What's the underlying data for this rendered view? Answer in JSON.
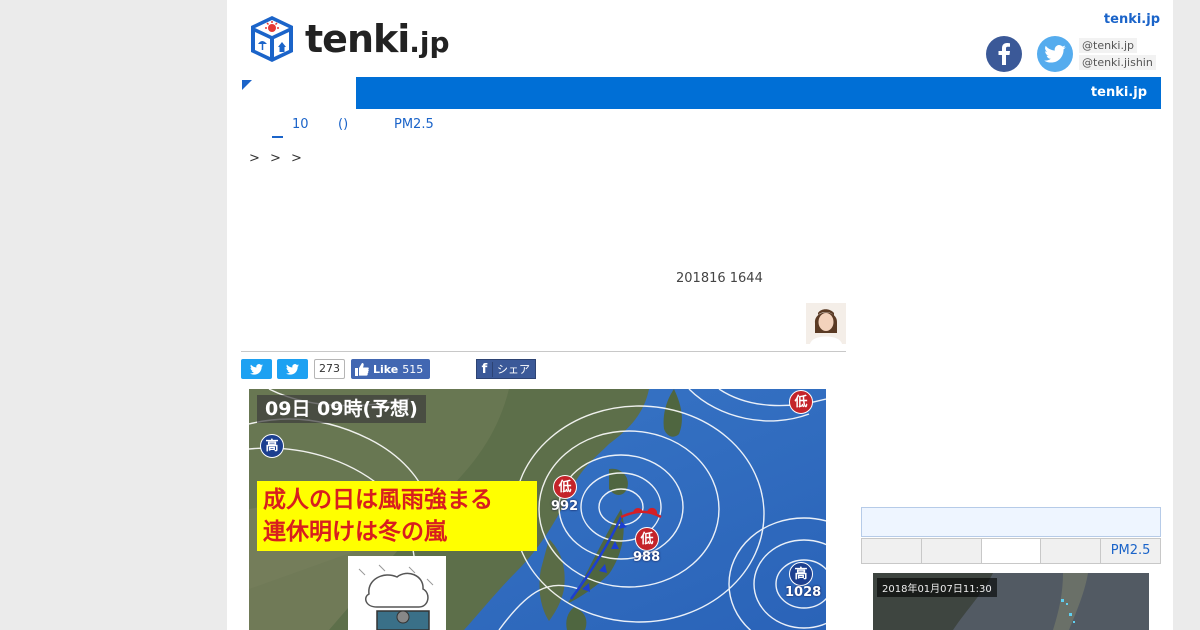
{
  "header": {
    "logo_text": "tenki",
    "logo_suffix": ".jp",
    "top_link": "tenki.jp",
    "social": {
      "handle_main": "@tenki.jp",
      "handle_jishin": "@tenki.jishin"
    }
  },
  "nav": {
    "title": "tenki.jp"
  },
  "subnav": {
    "items": [
      "10",
      "()",
      "PM2.5"
    ]
  },
  "breadcrumb": "> > >",
  "article": {
    "date": "201816 1644"
  },
  "share": {
    "tweet_count": "273",
    "like_label": "Like",
    "like_count": "515",
    "share_label": "シェア"
  },
  "weather_map": {
    "title": "09日 09時(予想)",
    "headline_line1": "成人の日は風雨強まる",
    "headline_line2": "連休明けは冬の嵐",
    "pressure_systems": [
      {
        "label": "低",
        "kind": "low",
        "value": "992"
      },
      {
        "label": "低",
        "kind": "low",
        "value": "988"
      },
      {
        "label": "低",
        "kind": "low",
        "value": ""
      },
      {
        "label": "高",
        "kind": "high",
        "value": ""
      },
      {
        "label": "高",
        "kind": "high",
        "value": "1028"
      }
    ]
  },
  "sidebar": {
    "tabs": [
      "",
      "",
      "",
      "",
      "PM2.5"
    ],
    "active_tab": 2,
    "radar_time": "2018年01月07日11:30"
  },
  "colors": {
    "brand_blue": "#006fd6",
    "link_blue": "#1b64c9",
    "facebook": "#3b5998",
    "twitter": "#55acee",
    "headline_yellow": "#ffff00",
    "headline_red": "#d81e1e"
  }
}
